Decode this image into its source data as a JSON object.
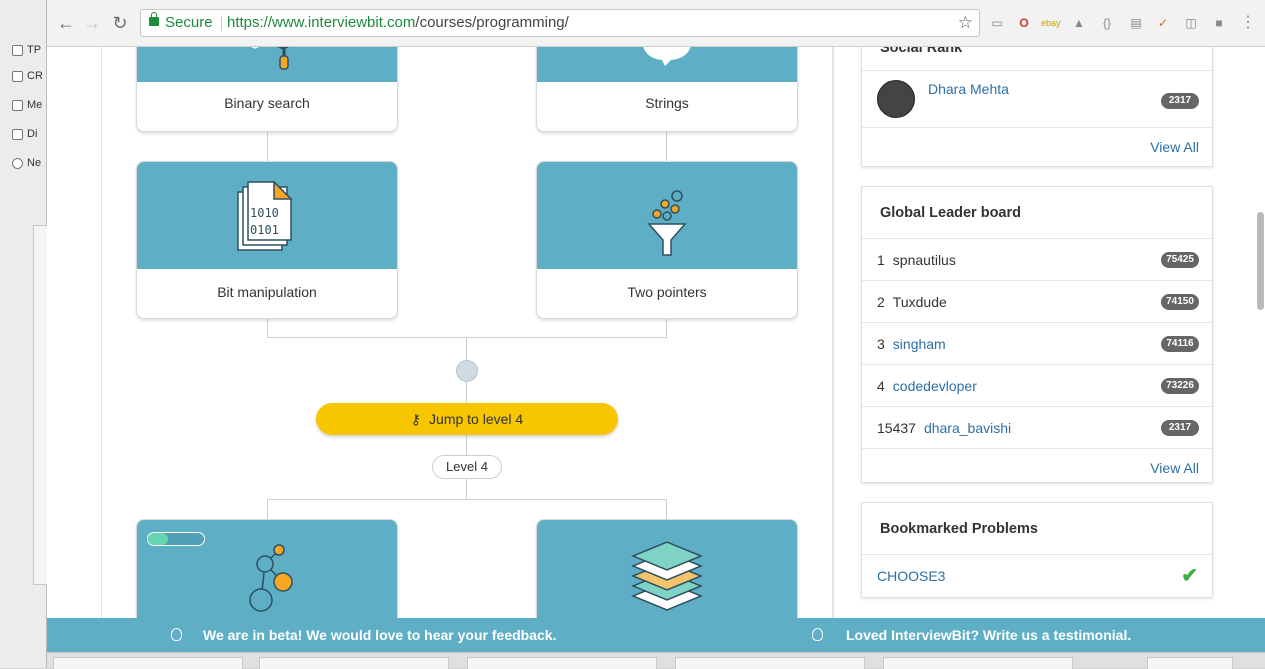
{
  "desktop": {
    "items": [
      {
        "label": "TP"
      },
      {
        "label": "CR"
      },
      {
        "label": "Me"
      },
      {
        "label": "Di"
      },
      {
        "label": "Ne"
      }
    ]
  },
  "browser": {
    "secure_label": "Secure",
    "url_host": "https://www.interviewbit.com",
    "url_path": "/courses/programming/"
  },
  "course": {
    "cards": [
      {
        "label": "Binary search",
        "icon": "magnifier-book-icon"
      },
      {
        "label": "Strings",
        "icon": "speech-bubble-icon"
      },
      {
        "label": "Bit manipulation",
        "icon": "binary-document-icon",
        "binary_row1": "1010",
        "binary_row2": "0101"
      },
      {
        "label": "Two pointers",
        "icon": "funnel-icon"
      },
      {
        "label": "",
        "icon": "graph-nodes-icon"
      },
      {
        "label": "",
        "icon": "stacked-layers-icon"
      }
    ],
    "jump_label": "Jump to level 4",
    "level_label": "Level 4"
  },
  "sidebar": {
    "social_rank": {
      "title": "Social Rank",
      "user": "Dhara Mehta",
      "score": "2317",
      "view_all": "View All"
    },
    "leaderboard": {
      "title": "Global Leader board",
      "rows": [
        {
          "rank": "1",
          "name": "spnautilus",
          "score": "75425",
          "link": false
        },
        {
          "rank": "2",
          "name": "Tuxdude",
          "score": "74150",
          "link": false
        },
        {
          "rank": "3",
          "name": "singham",
          "score": "74116",
          "link": true
        },
        {
          "rank": "4",
          "name": "codedevloper",
          "score": "73226",
          "link": true
        },
        {
          "rank": "15437",
          "name": "dhara_bavishi",
          "score": "2317",
          "link": true
        }
      ],
      "view_all": "View All"
    },
    "bookmarks": {
      "title": "Bookmarked Problems",
      "item": "CHOOSE3"
    }
  },
  "footer": {
    "beta_text": "We are in beta! We would love to hear your feedback.",
    "testimonial_text": "Loved InterviewBit? Write us a testimonial."
  },
  "colors": {
    "teal": "#5eafc6",
    "yellow": "#f7c600",
    "link": "#2b6fa8",
    "secure_green": "#1e8a3c"
  }
}
